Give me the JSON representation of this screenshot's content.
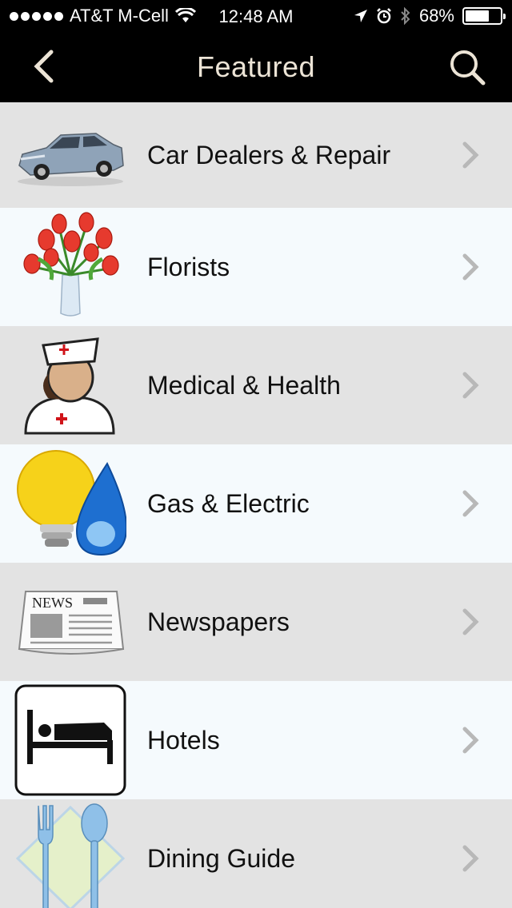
{
  "status": {
    "carrier": "AT&T M-Cell",
    "time": "12:48 AM",
    "battery": "68%",
    "battery_level": 0.68
  },
  "nav": {
    "title": "Featured",
    "back_icon": "chevron-left-icon",
    "search_icon": "search-icon"
  },
  "colors": {
    "row_odd": "#e3e3e3",
    "row_even": "#f5fafd",
    "title": "#ece4d6",
    "chevron": "#b8b8b8"
  },
  "categories": [
    {
      "label": "Car Dealers & Repair",
      "icon": "car-icon"
    },
    {
      "label": "Florists",
      "icon": "flowers-icon"
    },
    {
      "label": "Medical & Health",
      "icon": "nurse-icon"
    },
    {
      "label": "Gas & Electric",
      "icon": "lightbulb-drop-icon"
    },
    {
      "label": "Newspapers",
      "icon": "newspaper-icon",
      "icon_text": "NEWS"
    },
    {
      "label": "Hotels",
      "icon": "bed-icon"
    },
    {
      "label": "Dining Guide",
      "icon": "fork-spoon-icon"
    }
  ]
}
